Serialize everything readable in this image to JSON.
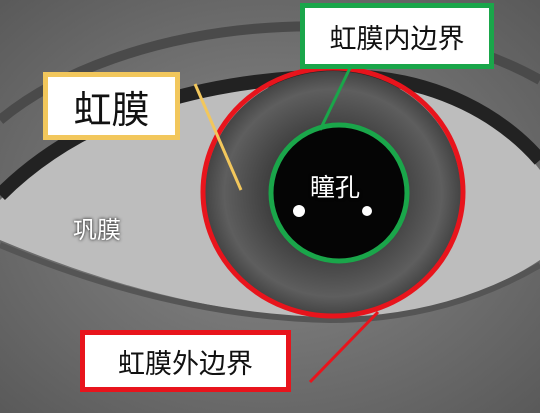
{
  "labels": {
    "inner_boundary": "虹膜内边界",
    "iris": "虹膜",
    "sclera": "巩膜",
    "pupil": "瞳孔",
    "outer_boundary": "虹膜外边界"
  },
  "colors": {
    "inner_boundary": "#1aa64a",
    "iris_label": "#f2c75c",
    "outer_boundary": "#e8141c"
  }
}
